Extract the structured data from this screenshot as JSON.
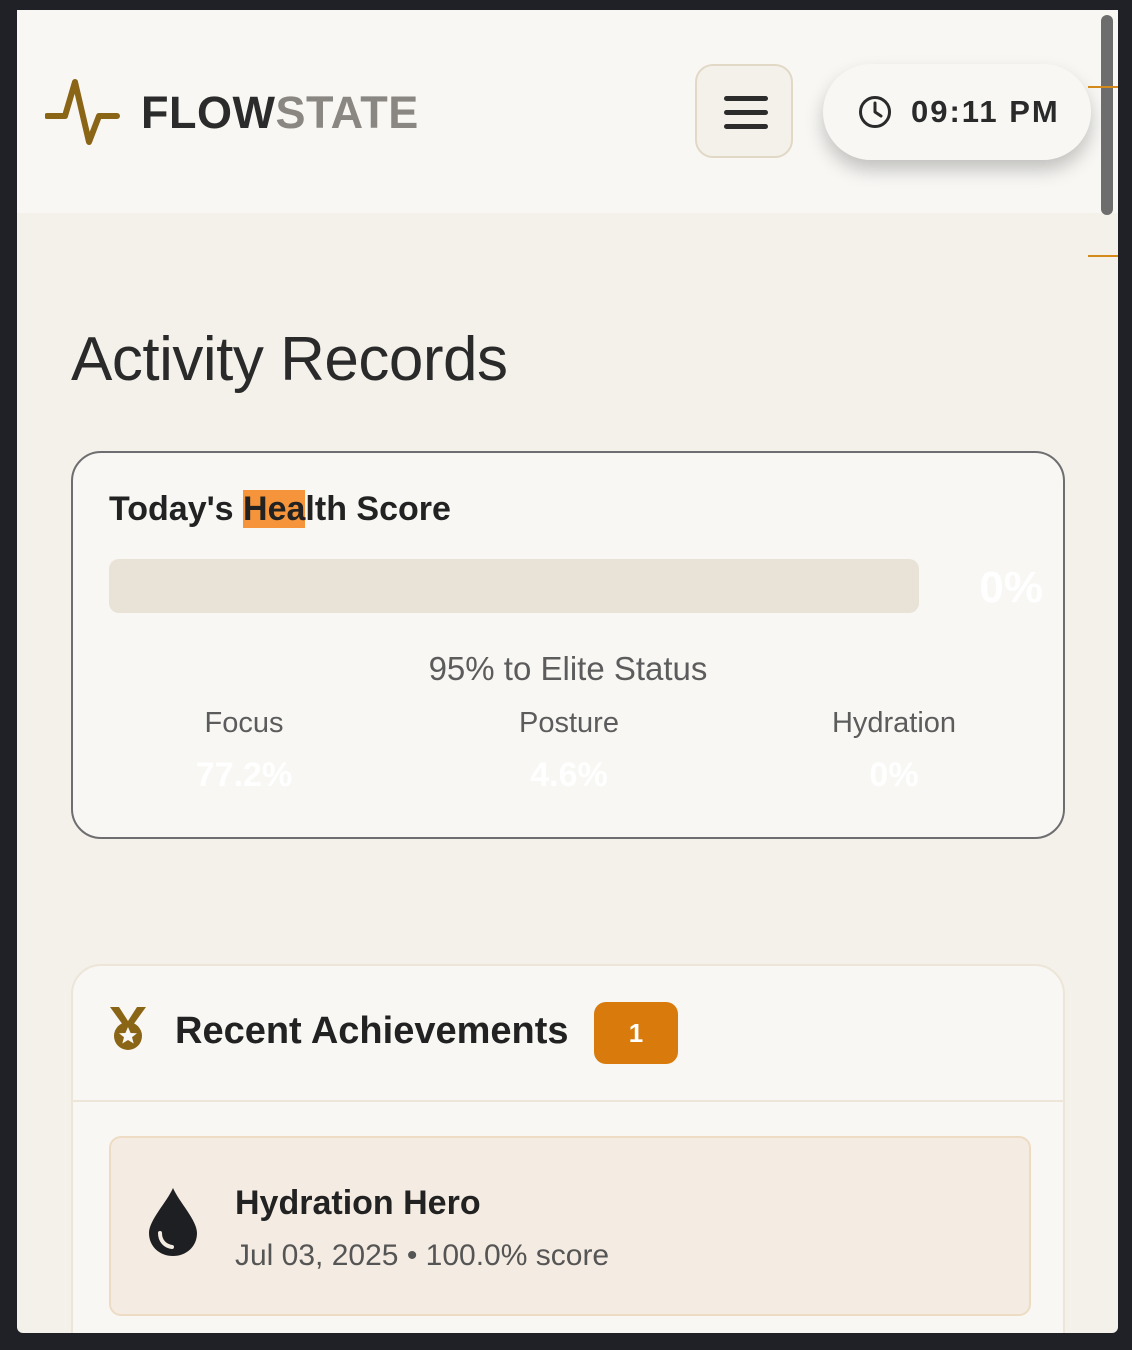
{
  "header": {
    "brand_part1": "FLOW",
    "brand_part2": "STATE",
    "logo_icon": "pulse-icon",
    "menu_icon": "hamburger-menu-icon",
    "clock_icon": "clock-icon",
    "time": "09:11 PM"
  },
  "page": {
    "title": "Activity Records"
  },
  "health_score": {
    "title_prefix": "Today's ",
    "title_highlight": "Hea",
    "title_suffix": "lth Score",
    "score_display": "0%",
    "score_fraction": 0,
    "elite_text": "95% to Elite Status",
    "metrics": [
      {
        "label": "Focus",
        "value": "77.2%"
      },
      {
        "label": "Posture",
        "value": "4.6%"
      },
      {
        "label": "Hydration",
        "value": "0%"
      }
    ]
  },
  "achievements": {
    "title": "Recent Achievements",
    "icon": "medal-icon",
    "count": "1",
    "items": [
      {
        "icon": "water-drop-icon",
        "name": "Hydration Hero",
        "date": "Jul 03, 2025",
        "separator": "•",
        "score": "100.0% score"
      }
    ]
  },
  "colors": {
    "accent": "#d97b0c",
    "logo": "#8b6516",
    "highlight": "#f5943a",
    "background": "#f4f1eb"
  }
}
